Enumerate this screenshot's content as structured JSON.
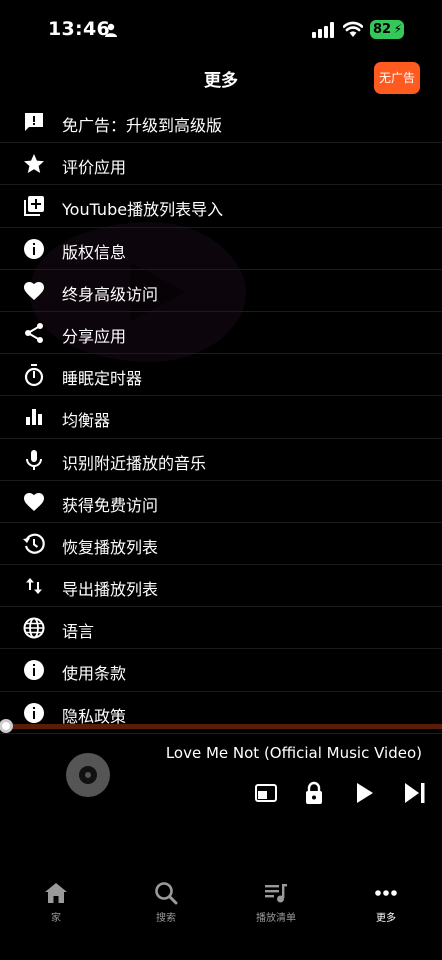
{
  "status_bar": {
    "time": "13:46",
    "battery": "82"
  },
  "header": {
    "title": "更多",
    "no_ads_label": "无广告"
  },
  "menu": {
    "items": [
      {
        "label": "免广告：升级到高级版",
        "icon": "feedback-icon"
      },
      {
        "label": "评价应用",
        "icon": "star-icon"
      },
      {
        "label": "YouTube播放列表导入",
        "icon": "playlist-add-icon"
      },
      {
        "label": "版权信息",
        "icon": "info-icon"
      },
      {
        "label": "终身高级访问",
        "icon": "heart-icon"
      },
      {
        "label": "分享应用",
        "icon": "share-icon"
      },
      {
        "label": "睡眠定时器",
        "icon": "timer-icon"
      },
      {
        "label": "均衡器",
        "icon": "equalizer-icon"
      },
      {
        "label": "识别附近播放的音乐",
        "icon": "microphone-icon"
      },
      {
        "label": "获得免费访问",
        "icon": "heart-icon"
      },
      {
        "label": "恢复播放列表",
        "icon": "history-icon"
      },
      {
        "label": "导出播放列表",
        "icon": "swap-vertical-icon"
      },
      {
        "label": "语言",
        "icon": "globe-icon"
      },
      {
        "label": "使用条款",
        "icon": "info-icon"
      },
      {
        "label": "隐私政策",
        "icon": "info-icon"
      }
    ]
  },
  "player": {
    "track_title": "Love Me Not (Official Music Video)",
    "progress": 0.01
  },
  "bottom_nav": {
    "items": [
      {
        "label": "家",
        "icon": "home-icon"
      },
      {
        "label": "搜索",
        "icon": "search-icon"
      },
      {
        "label": "播放清单",
        "icon": "playlist-icon"
      },
      {
        "label": "更多",
        "icon": "more-icon"
      }
    ],
    "active": "更多"
  },
  "colors": {
    "accent": "#ff5a1f",
    "battery": "#34c759",
    "progress": "#7a2a0a"
  }
}
